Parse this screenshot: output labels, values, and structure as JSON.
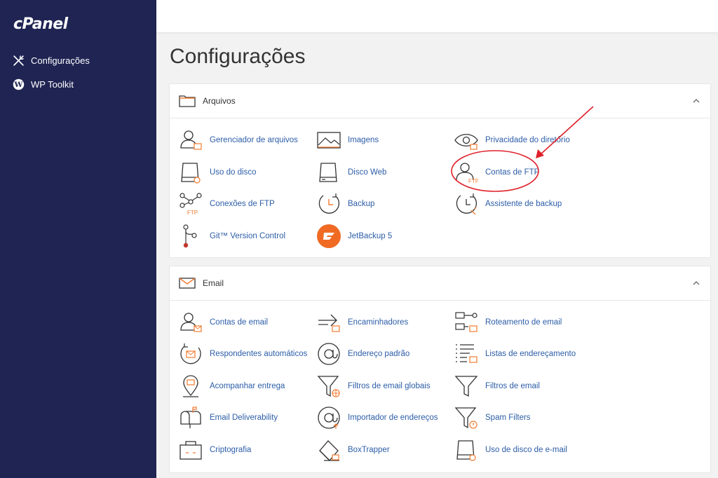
{
  "logo": "cPanel",
  "sidebar": {
    "items": [
      {
        "label": "Configurações"
      },
      {
        "label": "WP Toolkit"
      }
    ]
  },
  "page_title": "Configurações",
  "sections": {
    "arquivos": {
      "title": "Arquivos",
      "items": [
        {
          "label": "Gerenciador de arquivos"
        },
        {
          "label": "Imagens"
        },
        {
          "label": "Privacidade do diretório"
        },
        {
          "label": "Uso do disco"
        },
        {
          "label": "Disco Web"
        },
        {
          "label": "Contas de FTP"
        },
        {
          "label": "Conexões de FTP"
        },
        {
          "label": "Backup"
        },
        {
          "label": "Assistente de backup"
        },
        {
          "label": "Git™ Version Control"
        },
        {
          "label": "JetBackup 5"
        }
      ]
    },
    "email": {
      "title": "Email",
      "items": [
        {
          "label": "Contas de email"
        },
        {
          "label": "Encaminhadores"
        },
        {
          "label": "Roteamento de email"
        },
        {
          "label": "Respondentes automáticos"
        },
        {
          "label": "Endereço padrão"
        },
        {
          "label": "Listas de endereçamento"
        },
        {
          "label": "Acompanhar entrega"
        },
        {
          "label": "Filtros de email globais"
        },
        {
          "label": "Filtros de email"
        },
        {
          "label": "Email Deliverability"
        },
        {
          "label": "Importador de endereços"
        },
        {
          "label": "Spam Filters"
        },
        {
          "label": "Criptografia"
        },
        {
          "label": "BoxTrapper"
        },
        {
          "label": "Uso de disco de e-mail"
        }
      ]
    }
  },
  "colors": {
    "sidebar_bg": "#1f2453",
    "link": "#2c5da7",
    "accent": "#f47b30",
    "annotation": "#e0202a"
  }
}
